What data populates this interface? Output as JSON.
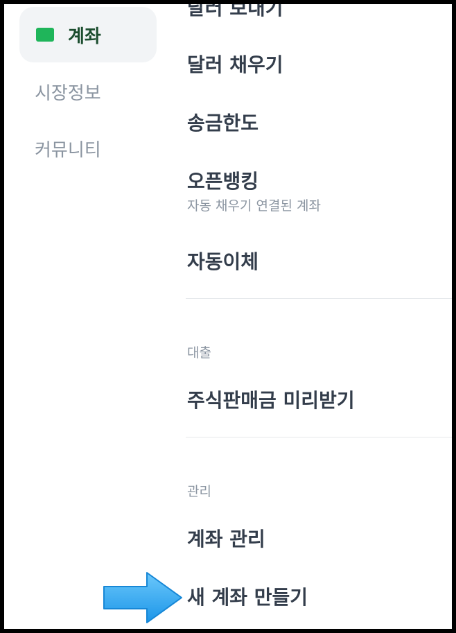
{
  "sidebar": {
    "items": [
      {
        "label": "계좌",
        "active": true,
        "icon": "card-icon",
        "icon_color": "#1fb55a"
      },
      {
        "label": "시장정보",
        "active": false
      },
      {
        "label": "커뮤니티",
        "active": false
      }
    ]
  },
  "menu": {
    "cut_off_top": "달러 보내기",
    "items": [
      {
        "label": "달러 채우기"
      },
      {
        "label": "송금한도"
      },
      {
        "label": "오픈뱅킹",
        "sub": "자동 채우기 연결된 계좌"
      },
      {
        "label": "자동이체"
      }
    ],
    "sections": [
      {
        "title": "대출",
        "items": [
          {
            "label": "주식판매금 미리받기"
          }
        ]
      },
      {
        "title": "관리",
        "items": [
          {
            "label": "계좌 관리"
          },
          {
            "label": "새 계좌 만들기"
          }
        ]
      }
    ]
  },
  "annotation": {
    "icon": "arrow-right-icon",
    "color": "#2aa8f2"
  }
}
